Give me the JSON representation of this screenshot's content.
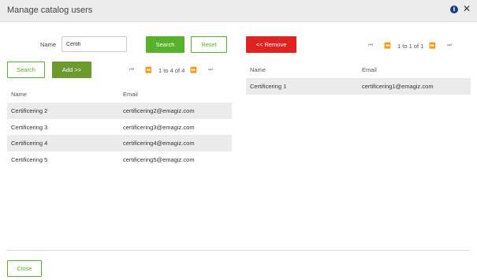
{
  "dialog": {
    "title": "Manage catalog users",
    "close_glyph": "✕",
    "info_glyph": "i"
  },
  "filter": {
    "name_label": "Name",
    "name_value": "Certifi",
    "search_label": "Search",
    "reset_label": "Reset"
  },
  "left": {
    "search_label": "Search",
    "add_label": "Add >>",
    "pager": {
      "text": "1 to 4 of 4",
      "first": "⏮",
      "prev": "⏪",
      "next": "⏩",
      "last": "⏭"
    },
    "columns": [
      "Name",
      "Email"
    ],
    "rows": [
      {
        "name": "Certificering 2",
        "email": "certificering2@emagiz.com"
      },
      {
        "name": "Certificering 3",
        "email": "certificering3@emagiz.com"
      },
      {
        "name": "Certificering 4",
        "email": "certificering4@emagiz.com"
      },
      {
        "name": "Certificering 5",
        "email": "certificering5@emagiz.com"
      }
    ]
  },
  "right": {
    "remove_label": "<< Remove",
    "pager": {
      "text": "1 to 1 of 1",
      "first": "⏮",
      "prev": "⏪",
      "next": "⏩",
      "last": "⏭"
    },
    "columns": [
      "Name",
      "Email"
    ],
    "rows": [
      {
        "name": "Certificering 1",
        "email": "certificering1@emagiz.com"
      }
    ]
  },
  "footer": {
    "close_label": "Close"
  },
  "colors": {
    "green": "#58b12b",
    "dark_green": "#6b9a2f",
    "red": "#e02222",
    "row_alt": "#ebebeb"
  }
}
